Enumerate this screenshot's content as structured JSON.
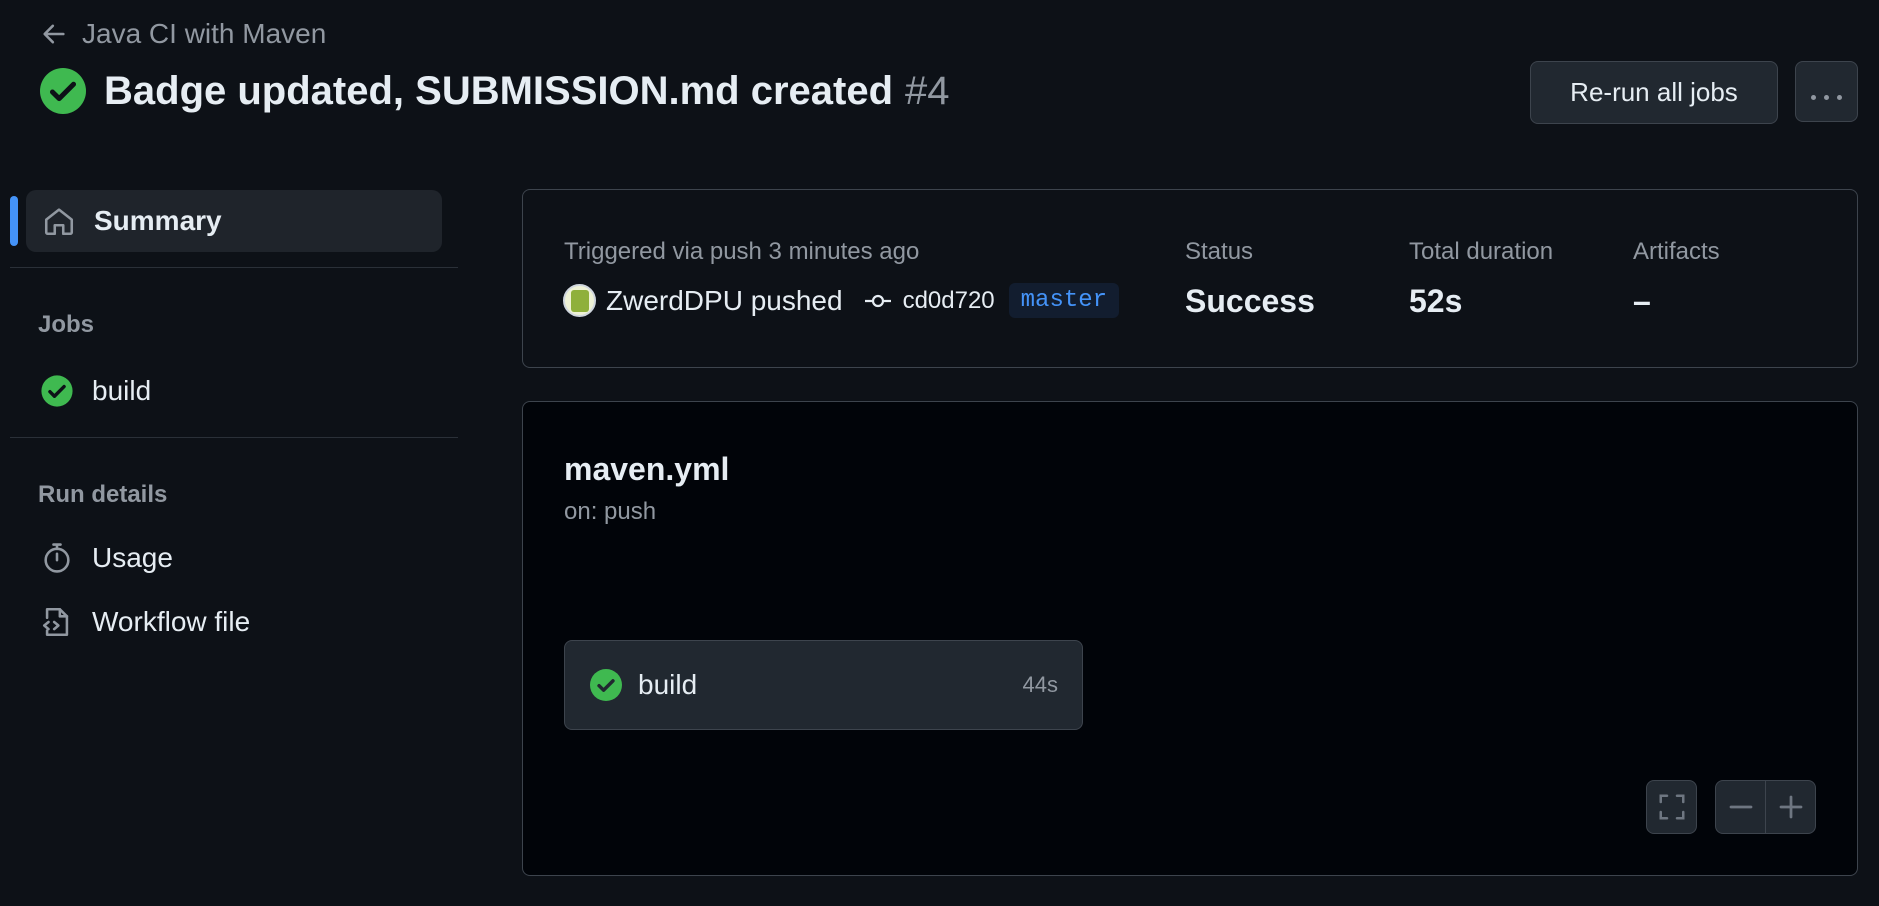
{
  "header": {
    "back_label": "Java CI with Maven",
    "title": "Badge updated, SUBMISSION.md created",
    "run_number": "#4",
    "rerun_label": "Re-run all jobs",
    "more_icon": "kebab-horizontal-icon"
  },
  "sidebar": {
    "summary_label": "Summary",
    "jobs_heading": "Jobs",
    "jobs": [
      {
        "label": "build",
        "status": "success"
      }
    ],
    "run_details_heading": "Run details",
    "run_details": [
      {
        "label": "Usage",
        "icon": "stopwatch-icon"
      },
      {
        "label": "Workflow file",
        "icon": "file-code-icon"
      }
    ]
  },
  "summary": {
    "triggered": "Triggered via push 3 minutes ago",
    "pusher": "ZwerdDPU pushed",
    "commit_sha": "cd0d720",
    "branch": "master",
    "status_label": "Status",
    "status_value": "Success",
    "duration_label": "Total duration",
    "duration_value": "52s",
    "artifacts_label": "Artifacts",
    "artifacts_value": "–"
  },
  "workflow": {
    "name": "maven.yml",
    "trigger": "on: push",
    "jobs": [
      {
        "name": "build",
        "duration": "44s",
        "status": "success"
      }
    ]
  },
  "colors": {
    "success": "#3fb950",
    "accent": "#4493f8",
    "background": "#0d1117"
  }
}
